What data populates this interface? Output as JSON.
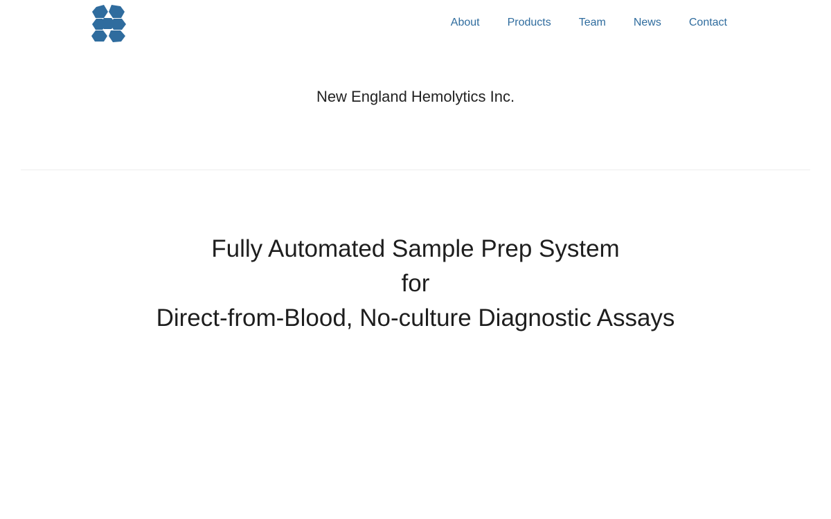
{
  "brand": {
    "logo_icon": "hexagon-cluster-logo-icon",
    "logo_color": "#2f6c9e"
  },
  "nav": {
    "items": [
      {
        "label": "About"
      },
      {
        "label": "Products"
      },
      {
        "label": "Team"
      },
      {
        "label": "News"
      },
      {
        "label": "Contact"
      }
    ],
    "link_color": "#2f6c9e"
  },
  "header": {
    "company_name": "New England Hemolytics Inc."
  },
  "hero": {
    "line1": "Fully Automated Sample Prep System",
    "line2": "for",
    "line3": "Direct-from-Blood, No-culture Diagnostic Assays"
  }
}
